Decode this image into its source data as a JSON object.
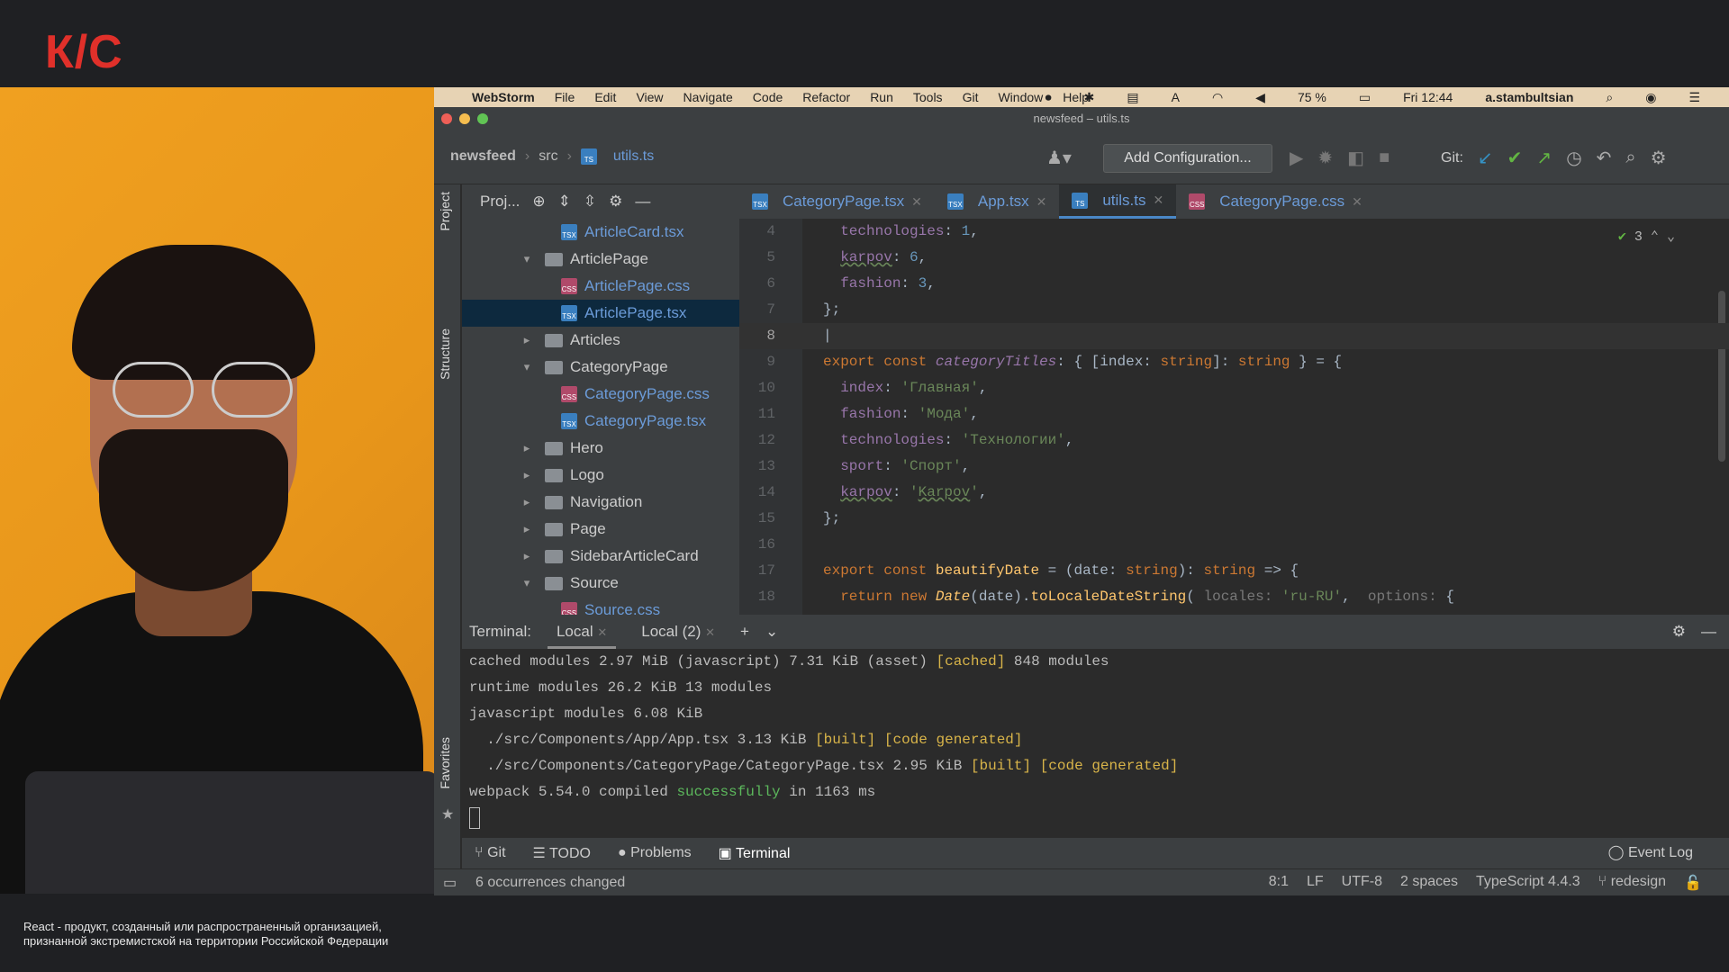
{
  "brand": {
    "logo_text": "К/С"
  },
  "disclaimer": {
    "line1": "React - продукт, созданный или распространенный организацией,",
    "line2": "признанной экстремистской на территории Российской Федерации"
  },
  "menubar": {
    "app": "WebStorm",
    "items": [
      "File",
      "Edit",
      "View",
      "Navigate",
      "Code",
      "Refactor",
      "Run",
      "Tools",
      "Git",
      "Window",
      "Help"
    ],
    "battery": "75 %",
    "clock": "Fri 12:44",
    "user": "a.stambultsian"
  },
  "window": {
    "title": "newsfeed – utils.ts"
  },
  "breadcrumbs": {
    "project": "newsfeed",
    "folder": "src",
    "file": "utils.ts"
  },
  "toolbar": {
    "add_config": "Add Configuration...",
    "git_label": "Git:"
  },
  "project_panel": {
    "header": "Proj...",
    "tree": [
      {
        "name": "ArticleCard.tsx",
        "type": "tsx",
        "depth": 2
      },
      {
        "name": "ArticlePage",
        "type": "folder",
        "depth": 1,
        "expanded": true
      },
      {
        "name": "ArticlePage.css",
        "type": "css",
        "depth": 2
      },
      {
        "name": "ArticlePage.tsx",
        "type": "tsx",
        "depth": 2,
        "selected": true
      },
      {
        "name": "Articles",
        "type": "folder",
        "depth": 1,
        "expanded": false
      },
      {
        "name": "CategoryPage",
        "type": "folder",
        "depth": 1,
        "expanded": true
      },
      {
        "name": "CategoryPage.css",
        "type": "css",
        "depth": 2
      },
      {
        "name": "CategoryPage.tsx",
        "type": "tsx",
        "depth": 2
      },
      {
        "name": "Hero",
        "type": "folder",
        "depth": 1,
        "expanded": false
      },
      {
        "name": "Logo",
        "type": "folder",
        "depth": 1,
        "expanded": false
      },
      {
        "name": "Navigation",
        "type": "folder",
        "depth": 1,
        "expanded": false
      },
      {
        "name": "Page",
        "type": "folder",
        "depth": 1,
        "expanded": false
      },
      {
        "name": "SidebarArticleCard",
        "type": "folder",
        "depth": 1,
        "expanded": false
      },
      {
        "name": "Source",
        "type": "folder",
        "depth": 1,
        "expanded": true
      },
      {
        "name": "Source.css",
        "type": "css",
        "depth": 2
      }
    ]
  },
  "side_labels": {
    "project": "Project",
    "structure": "Structure",
    "favorites": "Favorites"
  },
  "editor_tabs": [
    {
      "label": "CategoryPage.tsx",
      "active": false
    },
    {
      "label": "App.tsx",
      "active": false
    },
    {
      "label": "utils.ts",
      "active": true
    },
    {
      "label": "CategoryPage.css",
      "active": false
    }
  ],
  "editor": {
    "problems_count": "3",
    "current_line": 8,
    "lines": [
      {
        "n": "4"
      },
      {
        "n": "5"
      },
      {
        "n": "6"
      },
      {
        "n": "7"
      },
      {
        "n": "8"
      },
      {
        "n": "9"
      },
      {
        "n": "10"
      },
      {
        "n": "11"
      },
      {
        "n": "12"
      },
      {
        "n": "13"
      },
      {
        "n": "14"
      },
      {
        "n": "15"
      },
      {
        "n": "16"
      },
      {
        "n": "17"
      },
      {
        "n": "18"
      }
    ],
    "tokens": {
      "technologies": "technologies",
      "karpov": "karpov",
      "fashion": "fashion",
      "index": "index",
      "sport": "sport",
      "v1": "1",
      "v6": "6",
      "v3": "3",
      "export": "export",
      "const": "const",
      "categoryTitles": "categoryTitles",
      "beautifyDate": "beautifyDate",
      "str_main": "'Главная'",
      "str_fashion": "'Мода'",
      "str_tech": "'Технологии'",
      "str_sport": "'Спорт'",
      "str_karpov_q1": "'",
      "str_karpov_word": "Karpov",
      "str_karpov_q2": "'",
      "line18_a": "return new ",
      "line18_date": "Date",
      "line18_b": "(date).",
      "line18_fn": "toLocaleDateString",
      "line18_c": "( ",
      "line18_hint_locales": "locales:",
      "line18_str": " 'ru-RU'",
      "line18_d": ",  ",
      "line18_hint_options": "options:",
      "line18_e": " {",
      "t_string": "string",
      "t_date": "date"
    }
  },
  "terminal": {
    "label": "Terminal:",
    "tabs": [
      "Local",
      "Local (2)"
    ],
    "lines": {
      "l1a": "cached modules 2.97 MiB (javascript) 7.31 KiB (asset) ",
      "l1b": "[cached]",
      "l1c": " 848 modules",
      "l2": "runtime modules 26.2 KiB 13 modules",
      "l3": "javascript modules 6.08 KiB",
      "l4a": "  ./src/Components/App/App.tsx 3.13 KiB ",
      "l4b": "[built] [code generated]",
      "l5a": "  ./src/Components/CategoryPage/CategoryPage.tsx 2.95 KiB ",
      "l5b": "[built] [code generated]",
      "l6a": "webpack 5.54.0 compiled ",
      "l6b": "successfully",
      "l6c": " in 1163 ms"
    }
  },
  "bottom_tools": {
    "git": "Git",
    "todo": "TODO",
    "problems": "Problems",
    "terminal": "Terminal",
    "event_log": "Event Log"
  },
  "status": {
    "message": "6 occurrences changed",
    "position": "8:1",
    "line_sep": "LF",
    "encoding": "UTF-8",
    "indent": "2 spaces",
    "language": "TypeScript 4.4.3",
    "branch": "redesign"
  },
  "colors": {
    "brand_red": "#e0302a",
    "accent_blue": "#4a88c7",
    "webcam_bg": "#e8961a"
  }
}
